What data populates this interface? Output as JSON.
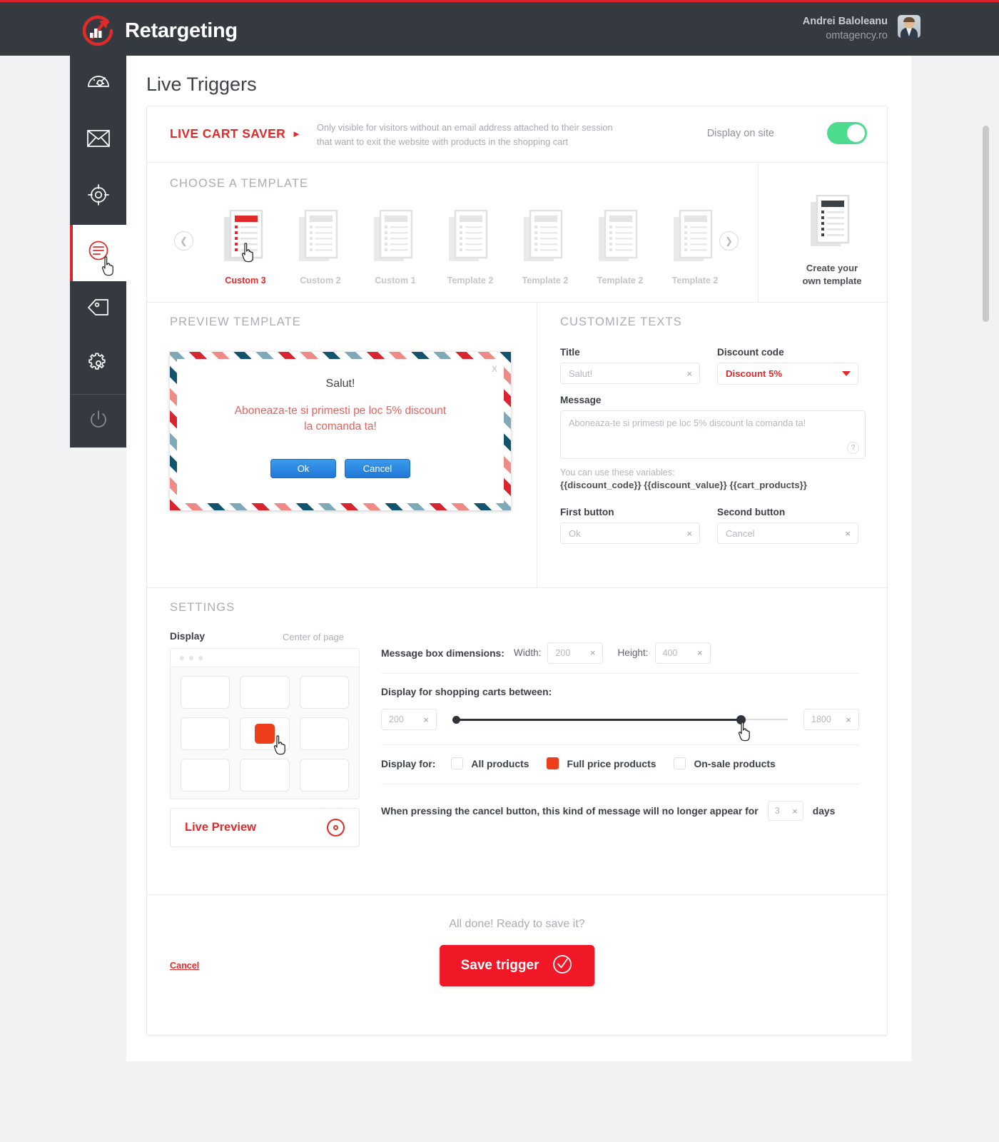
{
  "topbar": {
    "brand": "Retargeting",
    "user_name": "Andrei Baloleanu",
    "user_site": "omtagency.ro"
  },
  "sidebar": {
    "items": [
      {
        "name": "dashboard",
        "icon": "dashboard-gauge-icon"
      },
      {
        "name": "email",
        "icon": "envelope-icon"
      },
      {
        "name": "targeting",
        "icon": "target-icon"
      },
      {
        "name": "live-triggers",
        "icon": "chat-message-icon",
        "active": true
      },
      {
        "name": "tags",
        "icon": "tag-icon"
      },
      {
        "name": "settings",
        "icon": "gear-icon"
      },
      {
        "name": "logout",
        "icon": "power-icon"
      }
    ]
  },
  "page": {
    "title": "Live Triggers"
  },
  "trigger": {
    "name": "LIVE CART SAVER",
    "description": "Only visible for visitors without an email address attached to their session that want to exit the website with products in the shopping cart",
    "display_on_site_label": "Display on site",
    "display_on_site": "on",
    "toggle_color": "#4ddb8f"
  },
  "choose_template": {
    "title": "CHOOSE A TEMPLATE",
    "templates": [
      {
        "label": "Custom 3",
        "selected": true
      },
      {
        "label": "Custom 2",
        "selected": false
      },
      {
        "label": "Custom 1",
        "selected": false
      },
      {
        "label": "Template 2",
        "selected": false
      },
      {
        "label": "Template 2",
        "selected": false
      },
      {
        "label": "Template 2",
        "selected": false
      },
      {
        "label": "Template 2",
        "selected": false
      }
    ],
    "prev_icon": "chevron-left-icon",
    "next_icon": "chevron-right-icon",
    "create_own": "Create your\nown template",
    "create_own_line1": "Create your",
    "create_own_line2": "own template"
  },
  "preview": {
    "title": "PREVIEW TEMPLATE",
    "close_label": "X",
    "popup_title": "Salut!",
    "popup_message_line1": "Aboneaza-te si primesti pe loc 5% discount",
    "popup_message_line2": "la comanda ta!",
    "btn_ok": "Ok",
    "btn_cancel": "Cancel"
  },
  "customize": {
    "title": "CUSTOMIZE TEXTS",
    "title_label": "Title",
    "title_value": "Salut!",
    "discount_label": "Discount code",
    "discount_value": "Discount 5%",
    "message_label": "Message",
    "message_value": "Aboneaza-te si primesti pe loc 5% discount la comanda ta!",
    "help_label": "?",
    "vars_intro": "You can use these variables:",
    "vars_list": "{{discount_code}} {{discount_value}} {{cart_products}}",
    "first_button_label": "First button",
    "first_button_value": "Ok",
    "second_button_label": "Second button",
    "second_button_value": "Cancel",
    "clear_icon": "×"
  },
  "settings": {
    "title": "SETTINGS",
    "display_label": "Display",
    "display_position": "Center of page",
    "selected_cell_index": 4,
    "selected_cell_color": "#ef3e1c",
    "live_preview": "Live Preview",
    "dimensions_label": "Message box dimensions:",
    "width_label": "Width:",
    "width_value": "200",
    "height_label": "Height:",
    "height_value": "400",
    "carts_between_label": "Display for shopping carts between:",
    "cart_min": "200",
    "cart_max": "1800",
    "display_for_label": "Display for:",
    "display_for_options": [
      {
        "label": "All products",
        "checked": false
      },
      {
        "label": "Full price products",
        "checked": true
      },
      {
        "label": "On-sale products",
        "checked": false
      }
    ],
    "cancel_text_before": "When pressing the cancel button, this kind of message will no longer appear for",
    "cancel_days": "3",
    "cancel_text_after": "days"
  },
  "save": {
    "all_done": "All done! Ready to save it?",
    "cancel": "Cancel",
    "save_trigger": "Save trigger",
    "check_icon": "check-circle-icon",
    "button_color": "#f01826"
  }
}
